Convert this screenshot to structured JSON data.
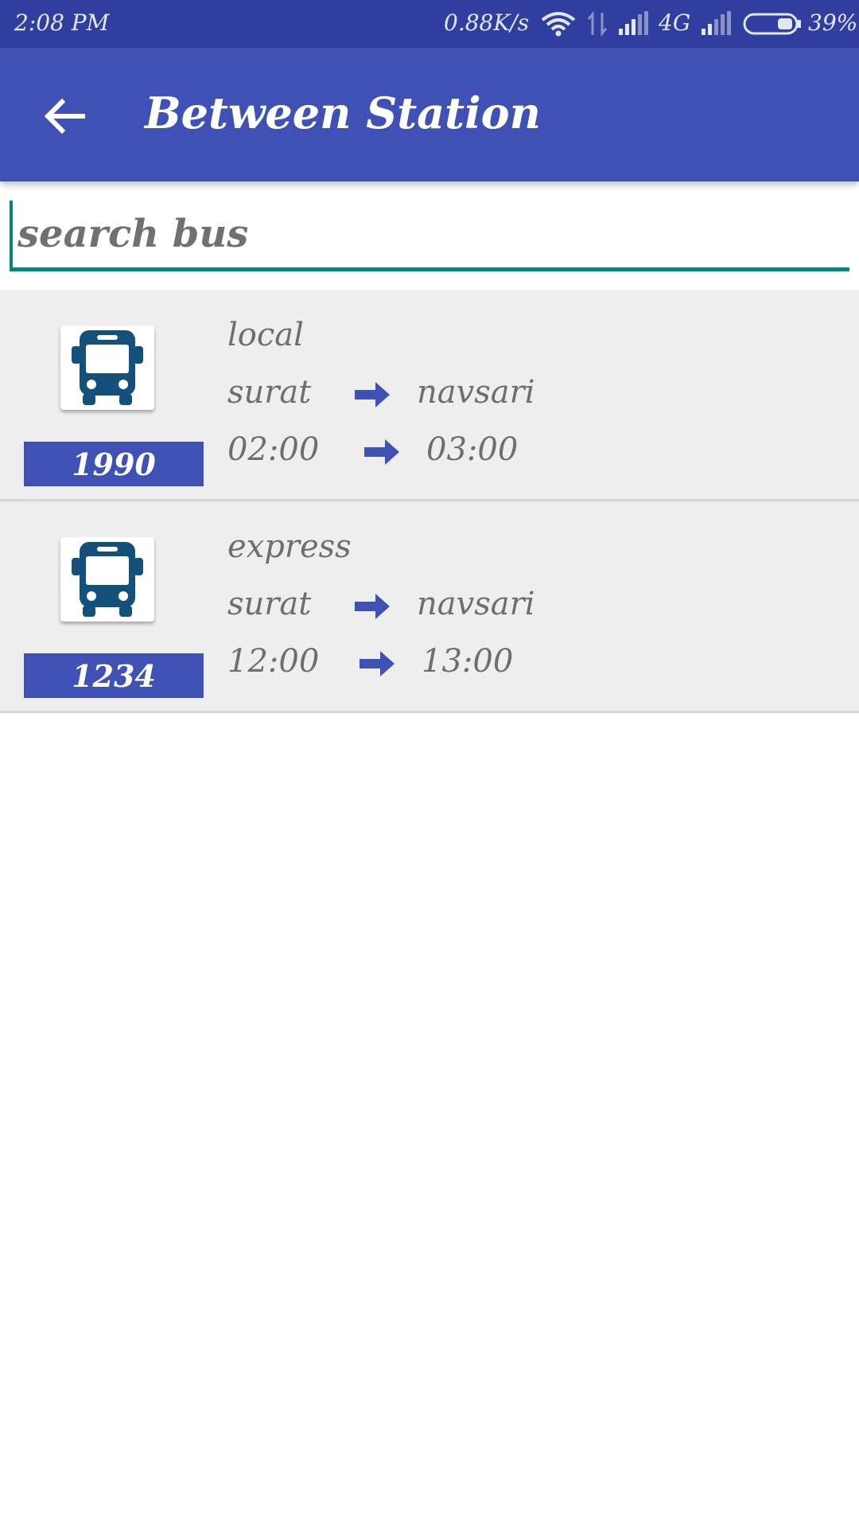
{
  "status_bar": {
    "time": "2:08 PM",
    "network_speed": "0.88K/s",
    "network_type": "4G",
    "battery": "39%",
    "icons": [
      "wifi-icon",
      "data-transfer-icon",
      "signal-icon",
      "signal-icon",
      "battery-icon"
    ]
  },
  "app_bar": {
    "title": "Between Station",
    "back_icon": "arrow-back-icon",
    "background_color": "#3f51b5"
  },
  "search": {
    "value": "",
    "placeholder": "search bus",
    "accent_color": "#00897b"
  },
  "buses": [
    {
      "number": "1990",
      "type": "local",
      "from": "surat",
      "to": "navsari",
      "departure": "02:00",
      "arrival": "03:00",
      "icon": "bus-icon"
    },
    {
      "number": "1234",
      "type": "express",
      "from": "surat",
      "to": "navsari",
      "departure": "12:00",
      "arrival": "13:00",
      "icon": "bus-icon"
    }
  ],
  "colors": {
    "primary": "#3f51b5",
    "primary_dark": "#303f9f",
    "accent": "#00897b",
    "bus_icon": "#13507a",
    "row_background": "#eeeeee"
  }
}
